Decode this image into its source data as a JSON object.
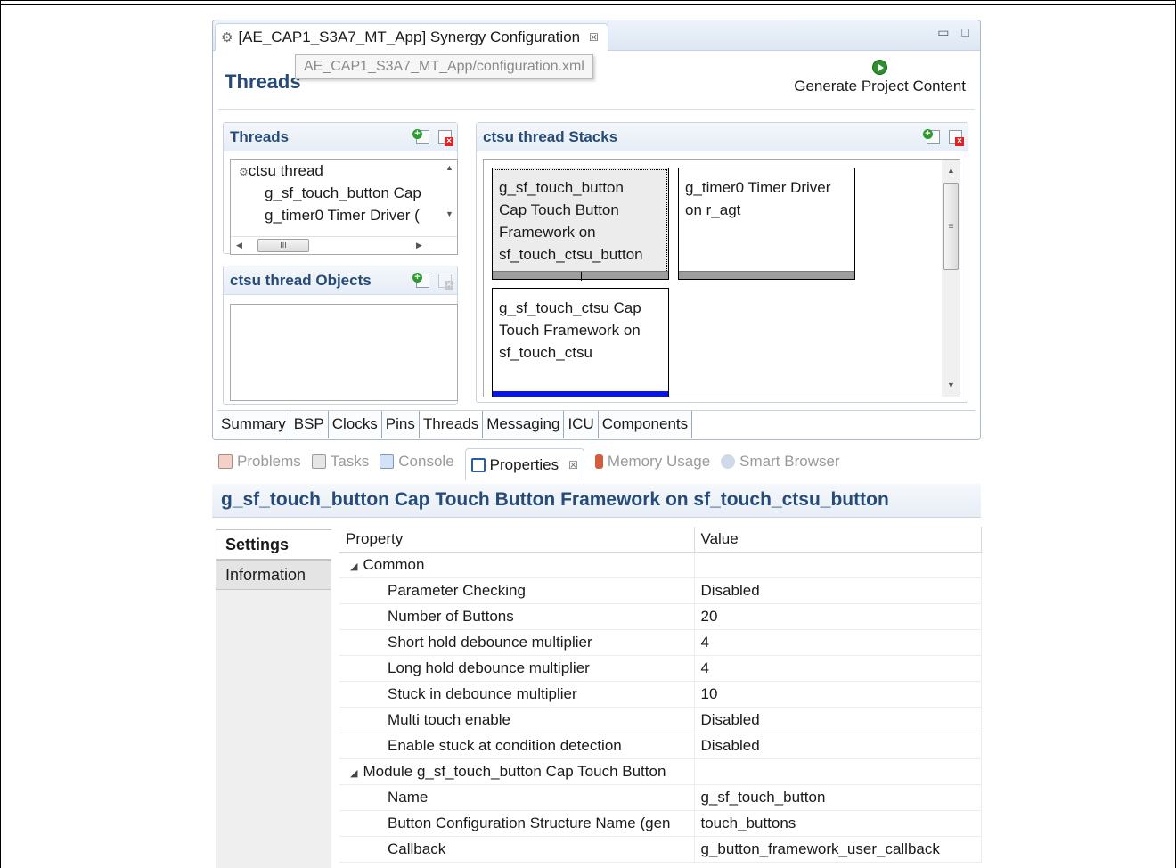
{
  "editor": {
    "tab_title": "[AE_CAP1_S3A7_MT_App] Synergy Configuration",
    "tab_close": "☒",
    "minimize": "▭",
    "maximize": "□",
    "tooltip": "AE_CAP1_S3A7_MT_App/configuration.xml",
    "form_title": "Threads",
    "generate_label": "Generate Project Content"
  },
  "threads_section": {
    "title": "Threads",
    "items": [
      {
        "label": "ctsu thread"
      },
      {
        "label": "g_sf_touch_button Cap"
      },
      {
        "label": "g_timer0 Timer Driver ("
      }
    ],
    "hscroll_thumb": "III"
  },
  "objects_section": {
    "title": "ctsu thread Objects"
  },
  "stacks_section": {
    "title": "ctsu thread Stacks",
    "modules": [
      {
        "line1": "g_sf_touch_button",
        "line2": "Cap Touch Button",
        "line3": "Framework on",
        "line4": "sf_touch_ctsu_button"
      },
      {
        "line1": "g_timer0 Timer Driver",
        "line2": "on r_agt"
      },
      {
        "line1": "g_sf_touch_ctsu Cap",
        "line2": "Touch Framework on",
        "line3": "sf_touch_ctsu"
      }
    ]
  },
  "page_tabs": [
    "Summary",
    "BSP",
    "Clocks",
    "Pins",
    "Threads",
    "Messaging",
    "ICU",
    "Components"
  ],
  "views": {
    "tabs": [
      "Problems",
      "Tasks",
      "Console",
      "Properties",
      "Memory Usage",
      "Smart Browser"
    ],
    "close": "☒",
    "properties_title": "g_sf_touch_button Cap Touch Button Framework on sf_touch_ctsu_button",
    "side_tabs": [
      "Settings",
      "Information"
    ],
    "columns": [
      "Property",
      "Value"
    ],
    "rows": [
      {
        "type": "group",
        "property": "Common",
        "value": ""
      },
      {
        "type": "item",
        "property": "Parameter Checking",
        "value": "Disabled"
      },
      {
        "type": "item",
        "property": "Number of Buttons",
        "value": "20"
      },
      {
        "type": "item",
        "property": "Short hold debounce multiplier",
        "value": "4"
      },
      {
        "type": "item",
        "property": "Long hold debounce multiplier",
        "value": "4"
      },
      {
        "type": "item",
        "property": "Stuck in debounce multiplier",
        "value": "10"
      },
      {
        "type": "item",
        "property": "Multi touch enable",
        "value": "Disabled"
      },
      {
        "type": "item",
        "property": "Enable stuck at condition detection",
        "value": "Disabled"
      },
      {
        "type": "group",
        "property": "Module g_sf_touch_button Cap Touch Button",
        "value": ""
      },
      {
        "type": "item",
        "property": "Name",
        "value": "g_sf_touch_button"
      },
      {
        "type": "item",
        "property": "Button Configuration Structure Name (gen",
        "value": "touch_buttons"
      },
      {
        "type": "item",
        "property": "Callback",
        "value": "g_button_framework_user_callback"
      }
    ]
  }
}
